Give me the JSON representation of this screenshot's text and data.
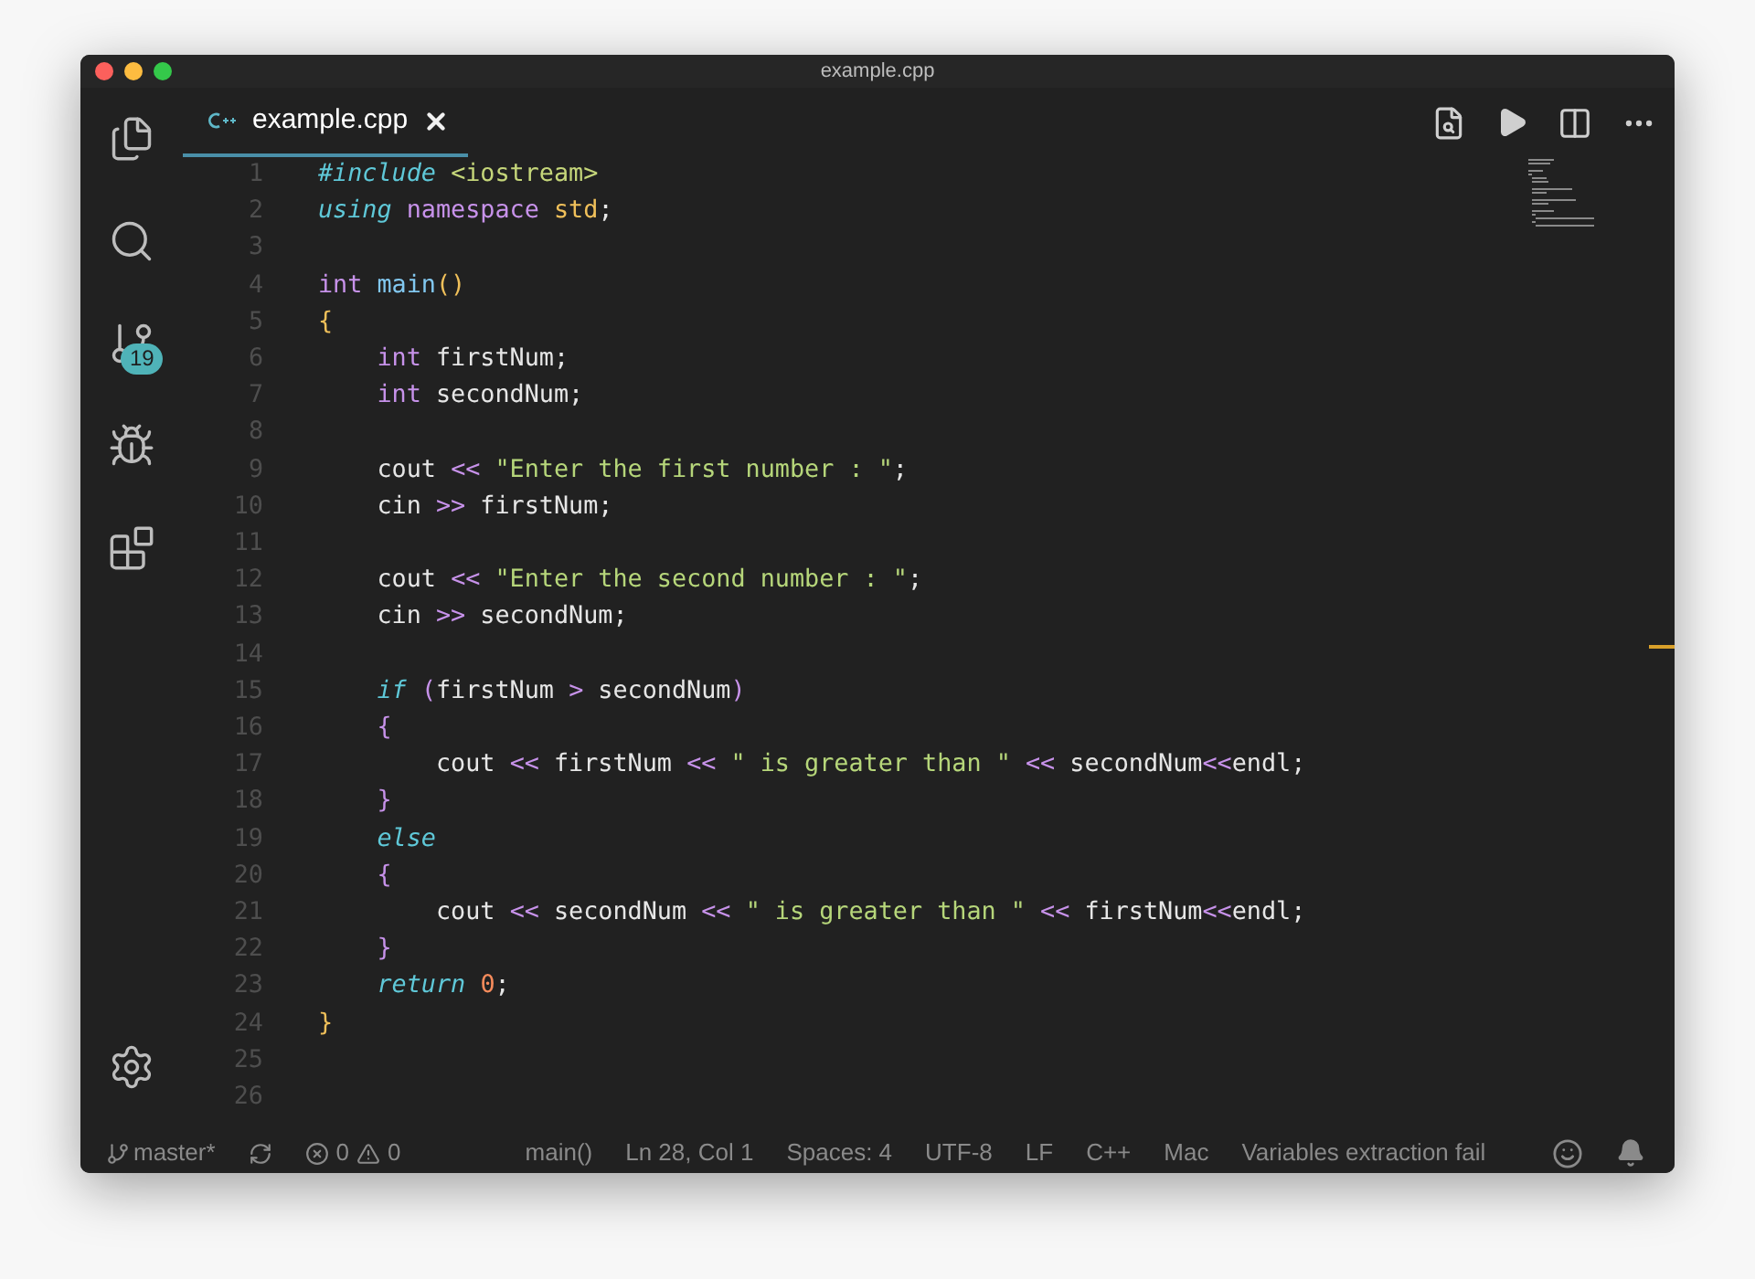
{
  "window": {
    "title": "example.cpp"
  },
  "activity_bar": {
    "items": [
      {
        "kind": "files"
      },
      {
        "kind": "search"
      },
      {
        "kind": "source-control",
        "badge": "19"
      },
      {
        "kind": "debug"
      },
      {
        "kind": "extensions"
      }
    ],
    "bottom": [
      {
        "kind": "settings"
      }
    ]
  },
  "tabs": [
    {
      "label": "example.cpp",
      "selected": true
    }
  ],
  "code": {
    "lines": [
      {
        "number": "1",
        "tokens": [
          {
            "kind": "keyword",
            "text": "#include "
          },
          {
            "kind": "include",
            "text": "<iostream>"
          }
        ]
      },
      {
        "number": "2",
        "tokens": [
          {
            "kind": "keyword",
            "text": "using "
          },
          {
            "kind": "storage",
            "text": "namespace "
          },
          {
            "kind": "ns",
            "text": "std"
          },
          {
            "kind": "plain",
            "text": ";"
          }
        ]
      },
      {
        "number": "3"
      },
      {
        "number": "4",
        "tokens": [
          {
            "kind": "storage",
            "text": "int "
          },
          {
            "kind": "func",
            "text": "main"
          },
          {
            "kind": "brace",
            "text": "()"
          }
        ]
      },
      {
        "number": "5",
        "tokens": [
          {
            "kind": "brace",
            "text": "{"
          }
        ]
      },
      {
        "number": "6",
        "tokens": [
          {
            "kind": "storage",
            "text": "    int"
          },
          {
            "kind": "plain",
            "text": " firstNum;"
          }
        ]
      },
      {
        "number": "7",
        "tokens": [
          {
            "kind": "storage",
            "text": "    int"
          },
          {
            "kind": "plain",
            "text": " secondNum;"
          }
        ]
      },
      {
        "number": "8"
      },
      {
        "number": "9",
        "tokens": [
          {
            "kind": "plain",
            "text": "    cout "
          },
          {
            "kind": "op",
            "text": "<< "
          },
          {
            "kind": "string",
            "text": "\"Enter the first number : \""
          },
          {
            "kind": "plain",
            "text": ";"
          }
        ]
      },
      {
        "number": "10",
        "tokens": [
          {
            "kind": "plain",
            "text": "    cin "
          },
          {
            "kind": "op",
            "text": ">>"
          },
          {
            "kind": "plain",
            "text": " firstNum;"
          }
        ]
      },
      {
        "number": "11"
      },
      {
        "number": "12",
        "tokens": [
          {
            "kind": "plain",
            "text": "    cout "
          },
          {
            "kind": "op",
            "text": "<< "
          },
          {
            "kind": "string",
            "text": "\"Enter the second number : \""
          },
          {
            "kind": "plain",
            "text": ";"
          }
        ]
      },
      {
        "number": "13",
        "tokens": [
          {
            "kind": "plain",
            "text": "    cin "
          },
          {
            "kind": "op",
            "text": ">>"
          },
          {
            "kind": "plain",
            "text": " secondNum;"
          }
        ]
      },
      {
        "number": "14"
      },
      {
        "number": "15",
        "tokens": [
          {
            "kind": "keyword",
            "text": "    if "
          },
          {
            "kind": "paren",
            "text": "("
          },
          {
            "kind": "plain",
            "text": "firstNum "
          },
          {
            "kind": "op",
            "text": ">"
          },
          {
            "kind": "plain",
            "text": " secondNum"
          },
          {
            "kind": "paren",
            "text": ")"
          }
        ]
      },
      {
        "number": "16",
        "tokens": [
          {
            "kind": "paren",
            "text": "    {"
          }
        ]
      },
      {
        "number": "17",
        "tokens": [
          {
            "kind": "plain",
            "text": "        cout "
          },
          {
            "kind": "op",
            "text": "<<"
          },
          {
            "kind": "plain",
            "text": " firstNum "
          },
          {
            "kind": "op",
            "text": "<< "
          },
          {
            "kind": "string",
            "text": "\" is greater than \""
          },
          {
            "kind": "op",
            "text": " <<"
          },
          {
            "kind": "plain",
            "text": " secondNum"
          },
          {
            "kind": "op",
            "text": "<<"
          },
          {
            "kind": "plain",
            "text": "endl;"
          }
        ]
      },
      {
        "number": "18",
        "tokens": [
          {
            "kind": "paren",
            "text": "    }"
          }
        ]
      },
      {
        "number": "19",
        "tokens": [
          {
            "kind": "keyword",
            "text": "    else"
          }
        ]
      },
      {
        "number": "20",
        "tokens": [
          {
            "kind": "paren",
            "text": "    {"
          }
        ]
      },
      {
        "number": "21",
        "tokens": [
          {
            "kind": "plain",
            "text": "        cout "
          },
          {
            "kind": "op",
            "text": "<<"
          },
          {
            "kind": "plain",
            "text": " secondNum "
          },
          {
            "kind": "op",
            "text": "<< "
          },
          {
            "kind": "string",
            "text": "\" is greater than \""
          },
          {
            "kind": "op",
            "text": " <<"
          },
          {
            "kind": "plain",
            "text": " firstNum"
          },
          {
            "kind": "op",
            "text": "<<"
          },
          {
            "kind": "plain",
            "text": "endl;"
          }
        ]
      },
      {
        "number": "22",
        "tokens": [
          {
            "kind": "paren",
            "text": "    }"
          }
        ]
      },
      {
        "number": "23",
        "tokens": [
          {
            "kind": "keyword",
            "text": "    return "
          },
          {
            "kind": "number",
            "text": "0"
          },
          {
            "kind": "plain",
            "text": ";"
          }
        ]
      },
      {
        "number": "24",
        "tokens": [
          {
            "kind": "brace",
            "text": "}"
          }
        ]
      },
      {
        "number": "25"
      },
      {
        "number": "26"
      }
    ]
  },
  "status_bar": {
    "branch": "master*",
    "errors": "0",
    "warnings": "0",
    "items": [
      "main()",
      "Ln 28, Col 1",
      "Spaces: 4",
      "UTF-8",
      "LF",
      "C++",
      "Mac",
      "Variables extraction fail"
    ]
  }
}
